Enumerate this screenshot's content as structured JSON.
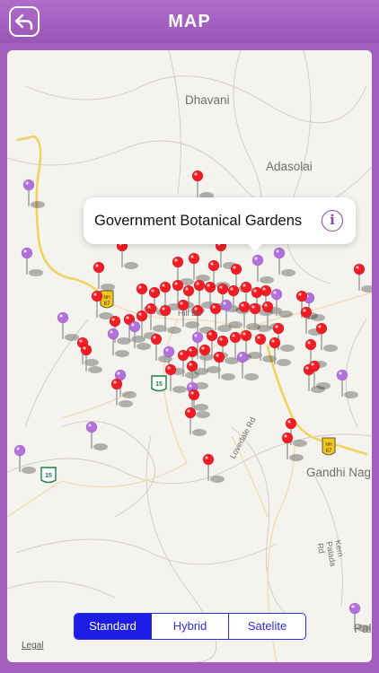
{
  "header": {
    "title": "MAP",
    "back_icon": "back-arrow-icon",
    "background": "#a25fbd"
  },
  "map": {
    "places": [
      "Dhavani",
      "Adasolai",
      "Gandhi Nag",
      "Hill Bu",
      "Lovedale Rd",
      "Pal",
      "Kern Palada Rd"
    ],
    "route_shields": [
      "NH 67",
      "NH 67",
      "15",
      "15"
    ],
    "callout": {
      "title": "Government Botanical Gardens",
      "info_icon": "info-icon"
    },
    "pin_colors": {
      "red": "#f21d24",
      "purple": "#b36fdc"
    }
  },
  "map_type_control": {
    "options": [
      "Standard",
      "Hybrid",
      "Satelite"
    ],
    "selected": "Standard",
    "accent": "#1d1de6"
  },
  "footer": {
    "legal": "Legal"
  }
}
